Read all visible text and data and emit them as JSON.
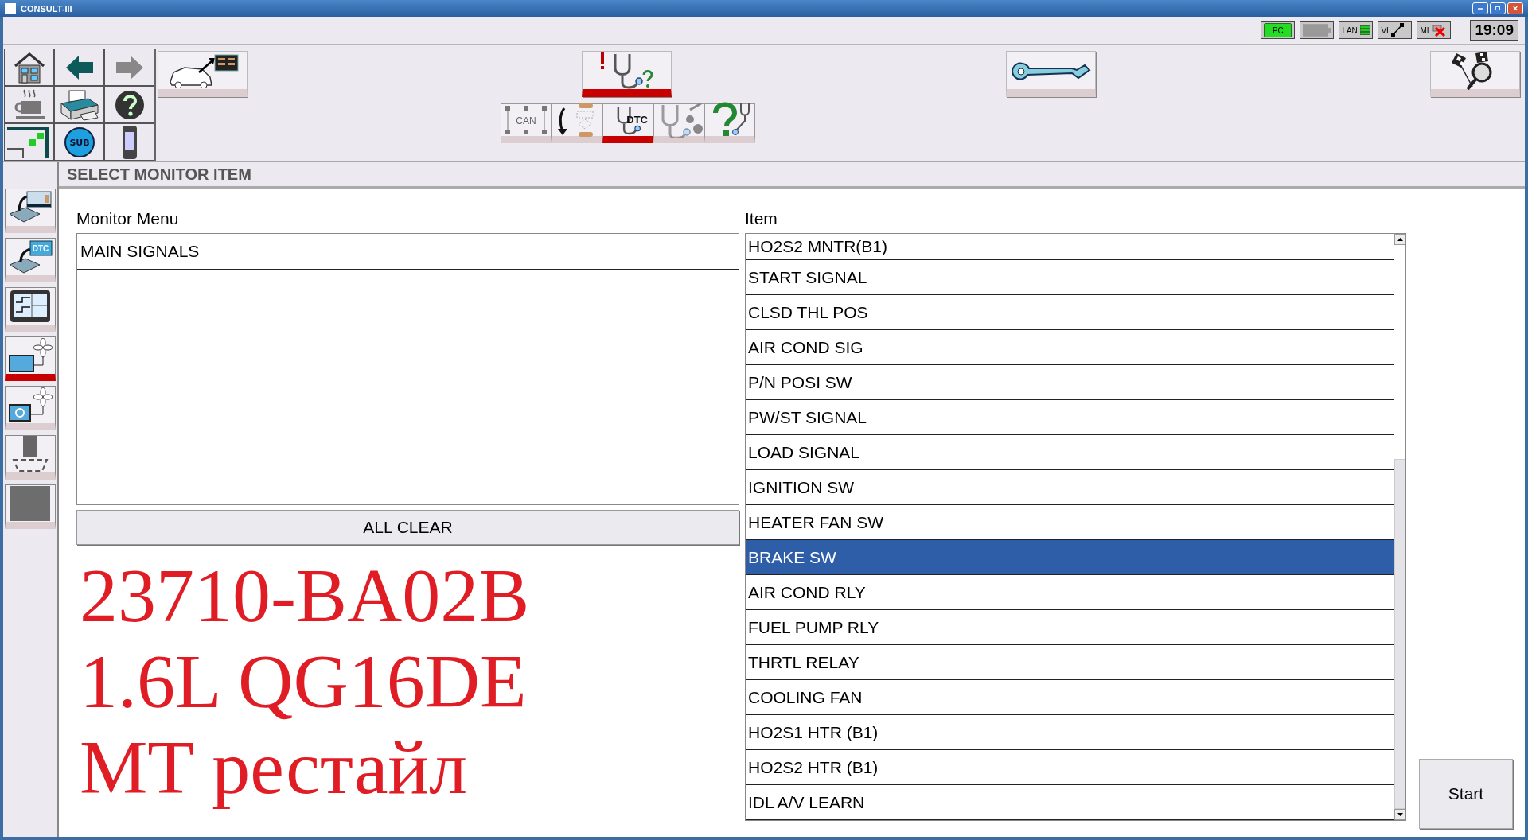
{
  "window": {
    "title": "CONSULT-III"
  },
  "status_bar": {
    "indicators": [
      {
        "kind": "pc",
        "label": "PC"
      },
      {
        "kind": "battery"
      },
      {
        "kind": "lan",
        "label": "LAN"
      },
      {
        "kind": "vi",
        "label": "VI"
      },
      {
        "kind": "mi",
        "label": "MI"
      }
    ],
    "time": "19:09"
  },
  "quick_grid": {
    "sub_label": "SUB"
  },
  "toolbar": {
    "main_buttons": [
      {
        "selected": false
      },
      {
        "selected": true
      },
      {
        "selected": false
      },
      {
        "selected": false
      }
    ],
    "sub_buttons": [
      {
        "label": "CAN",
        "selected": false
      },
      {
        "selected": false
      },
      {
        "label": "DTC",
        "selected": true
      },
      {
        "selected": false
      },
      {
        "selected": false
      }
    ]
  },
  "sidebar": {
    "items": [
      {
        "selected": false
      },
      {
        "label": "DTC",
        "selected": false
      },
      {
        "selected": false
      },
      {
        "selected": true
      },
      {
        "selected": false
      },
      {
        "selected": false
      },
      {
        "selected": false
      }
    ]
  },
  "panel": {
    "title": "SELECT MONITOR ITEM",
    "monitor_menu": {
      "label": "Monitor Menu",
      "items": [
        {
          "text": "MAIN SIGNALS",
          "selected": false
        }
      ],
      "clear_button": "ALL CLEAR"
    },
    "item_list": {
      "label": "Item",
      "items": [
        {
          "text": "HO2S2 MNTR(B1)",
          "selected": false
        },
        {
          "text": "START SIGNAL",
          "selected": false
        },
        {
          "text": "CLSD THL POS",
          "selected": false
        },
        {
          "text": "AIR COND SIG",
          "selected": false
        },
        {
          "text": "P/N POSI SW",
          "selected": false
        },
        {
          "text": "PW/ST SIGNAL",
          "selected": false
        },
        {
          "text": "LOAD SIGNAL",
          "selected": false
        },
        {
          "text": "IGNITION SW",
          "selected": false
        },
        {
          "text": "HEATER FAN SW",
          "selected": false
        },
        {
          "text": "BRAKE SW",
          "selected": true
        },
        {
          "text": "AIR COND RLY",
          "selected": false
        },
        {
          "text": "FUEL PUMP RLY",
          "selected": false
        },
        {
          "text": "THRTL RELAY",
          "selected": false
        },
        {
          "text": "COOLING FAN",
          "selected": false
        },
        {
          "text": "HO2S1 HTR (B1)",
          "selected": false
        },
        {
          "text": "HO2S2 HTR (B1)",
          "selected": false
        },
        {
          "text": "IDL A/V LEARN",
          "selected": false
        }
      ]
    },
    "start_button": "Start"
  },
  "annotation": {
    "lines": [
      "23710-BA02B",
      "1.6L QG16DE",
      "MT рестайл"
    ]
  }
}
